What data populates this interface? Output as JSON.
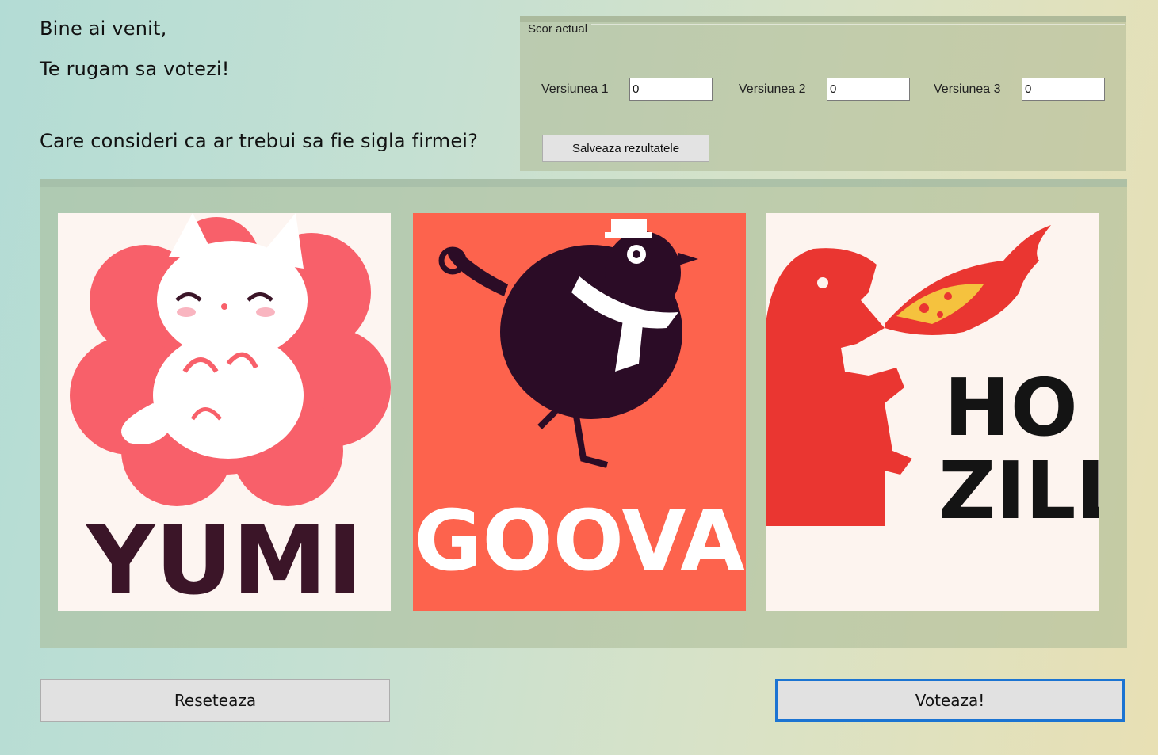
{
  "intro": {
    "welcome": "Bine ai venit,",
    "request": "Te rugam sa votezi!",
    "question": "Care consideri ca ar trebui sa fie sigla firmei?"
  },
  "score": {
    "title": "Scor actual",
    "versions": [
      {
        "label": "Versiunea 1",
        "value": "0"
      },
      {
        "label": "Versiunea 2",
        "value": "0"
      },
      {
        "label": "Versiunea 3",
        "value": "0"
      }
    ],
    "save_label": "Salveaza rezultatele"
  },
  "logos": [
    {
      "text": "YUMI",
      "icon": "cat-icon",
      "bg": "#fdf5f1",
      "accent": "#f8606a",
      "text_color": "#3b1528"
    },
    {
      "text": "GOOVA",
      "icon": "bird-icon",
      "bg": "#fd634d",
      "accent": "#2b0c26",
      "text_color": "#ffffff"
    },
    {
      "text_line1": "HO",
      "text_line2": "ZILL",
      "icon": "dinosaur-icon",
      "bg": "#fdf4ef",
      "accent": "#ea3631",
      "text_color": "#141414"
    }
  ],
  "actions": {
    "reset_label": "Reseteaza",
    "vote_label": "Voteaza!"
  },
  "colors": {
    "vote_focus_border": "#1b74d2"
  }
}
